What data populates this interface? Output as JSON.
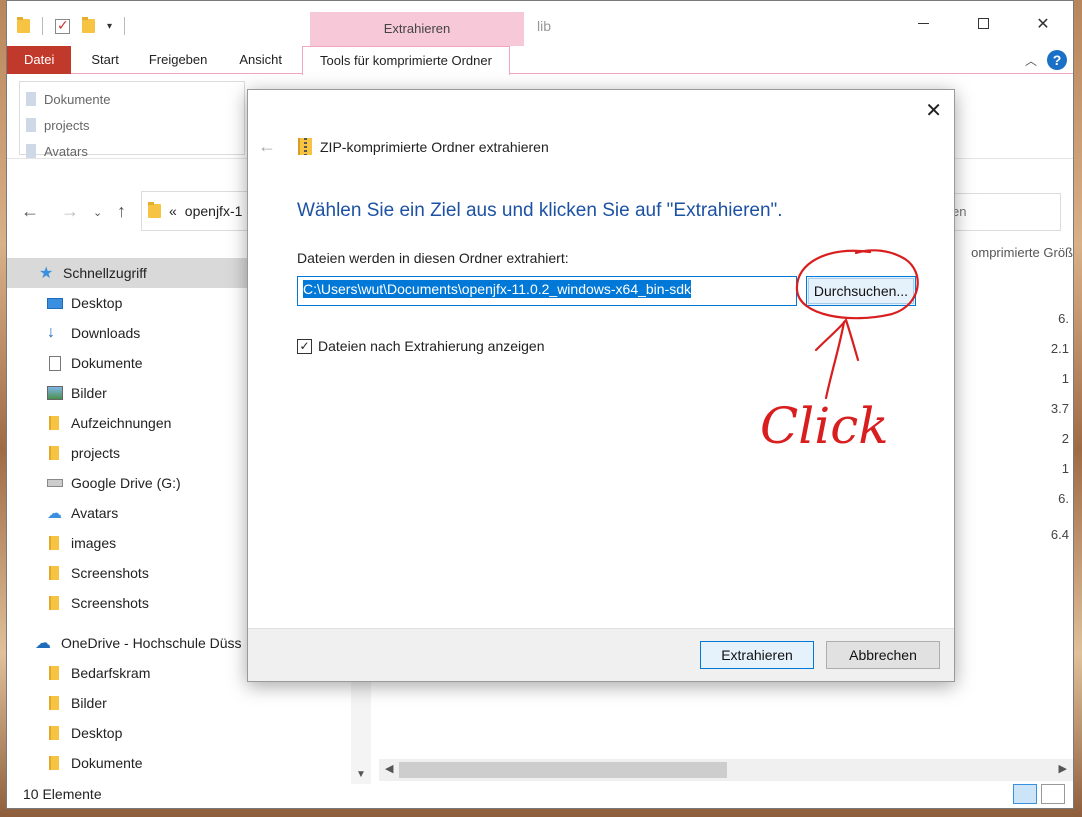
{
  "titlebar": {
    "context_tab": "Extrahieren",
    "title": "lib",
    "close_glyph": "✕"
  },
  "ribbon": {
    "tabs": [
      "Datei",
      "Start",
      "Freigeben",
      "Ansicht",
      "Tools für komprimierte Ordner"
    ],
    "help": "?",
    "quick_list": [
      "Dokumente",
      "projects",
      "Avatars"
    ]
  },
  "address": {
    "crumb_prefix": "«",
    "crumb": "openjfx-1",
    "search_partial": "en"
  },
  "navpane": {
    "items": [
      {
        "label": "Schnellzugriff",
        "icon": "star-icon"
      },
      {
        "label": "Desktop",
        "icon": "desktop-icon"
      },
      {
        "label": "Downloads",
        "icon": "download-icon"
      },
      {
        "label": "Dokumente",
        "icon": "document-icon"
      },
      {
        "label": "Bilder",
        "icon": "pictures-icon"
      },
      {
        "label": "Aufzeichnungen",
        "icon": "folder-icon"
      },
      {
        "label": "projects",
        "icon": "folder-icon"
      },
      {
        "label": "Google Drive (G:)",
        "icon": "drive-icon"
      },
      {
        "label": "Avatars",
        "icon": "cloud-icon"
      },
      {
        "label": "images",
        "icon": "folder-icon"
      },
      {
        "label": "Screenshots",
        "icon": "folder-icon"
      },
      {
        "label": "Screenshots",
        "icon": "folder-icon"
      },
      {
        "label": "OneDrive - Hochschule Düss",
        "icon": "onedrive-icon"
      },
      {
        "label": "Bedarfskram",
        "icon": "folder-icon"
      },
      {
        "label": "Bilder",
        "icon": "folder-icon"
      },
      {
        "label": "Desktop",
        "icon": "folder-icon"
      },
      {
        "label": "Dokumente",
        "icon": "folder-icon"
      }
    ]
  },
  "content": {
    "column_header": "omprimierte Größ",
    "sizes": [
      "6.",
      "2.1",
      "1",
      "3.7",
      "2",
      "1",
      "6.",
      "",
      "6.4"
    ]
  },
  "statusbar": {
    "count": "10 Elemente"
  },
  "dialog": {
    "header": "ZIP-komprimierte Ordner extrahieren",
    "main_title": "Wählen Sie ein Ziel aus und klicken Sie auf \"Extrahieren\".",
    "label": "Dateien werden in diesen Ordner extrahiert:",
    "path": "C:\\Users\\wut\\Documents\\openjfx-11.0.2_windows-x64_bin-sdk",
    "browse": "Durchsuchen...",
    "checkbox_label": "Dateien nach Extrahierung anzeigen",
    "checkbox_checked": true,
    "extract_btn": "Extrahieren",
    "cancel_btn": "Abbrechen"
  },
  "annotation": {
    "text": "Click",
    "color": "#d81e1e"
  }
}
